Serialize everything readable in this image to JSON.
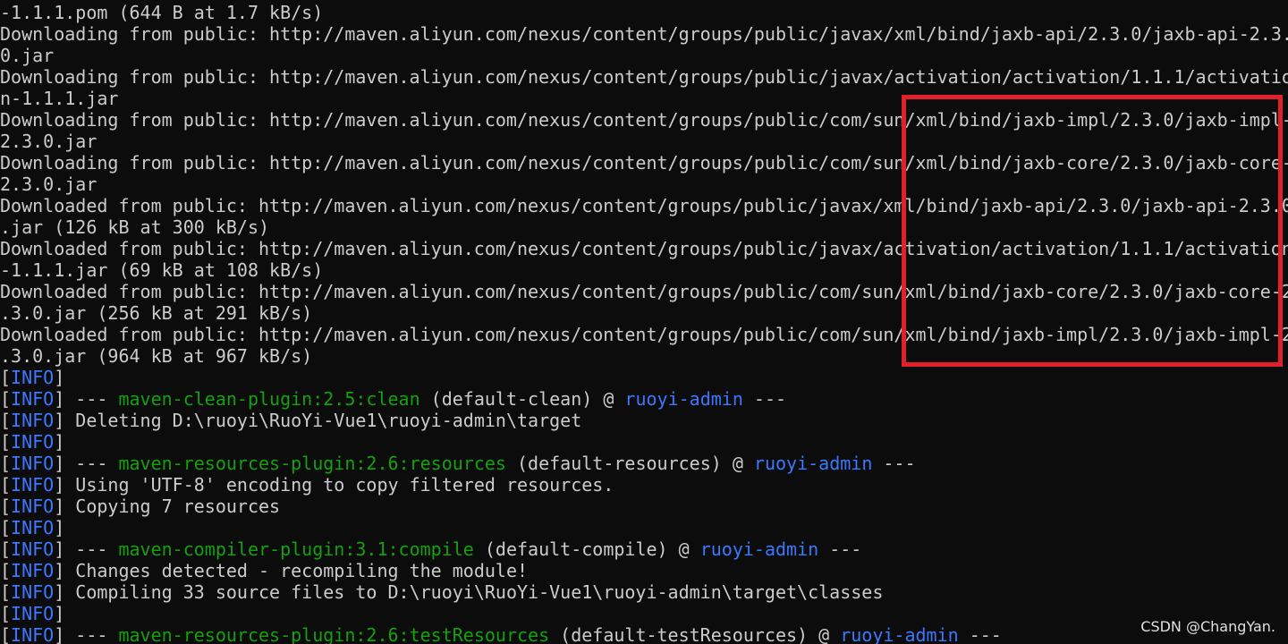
{
  "colors": {
    "background": "#0c0c0c",
    "default_text": "#cccccc",
    "info_tag": "#3b78ff",
    "plugin_green": "#13a10e",
    "artifact_blue": "#3b78ff",
    "highlight_box": "#e0202a"
  },
  "terminal": {
    "lines": [
      {
        "segments": [
          {
            "t": "-1.1.1.pom (644 B at 1.7 kB/s)",
            "c": "default"
          }
        ]
      },
      {
        "segments": [
          {
            "t": "Downloading from public: http://maven.aliyun.com/nexus/content/groups/public/javax/xml/bind/jaxb-api/2.3.0/jaxb-api-2.3.",
            "c": "default"
          }
        ]
      },
      {
        "segments": [
          {
            "t": "0.jar",
            "c": "default"
          }
        ]
      },
      {
        "segments": [
          {
            "t": "Downloading from public: http://maven.aliyun.com/nexus/content/groups/public/javax/activation/activation/1.1.1/activatio",
            "c": "default"
          }
        ]
      },
      {
        "segments": [
          {
            "t": "n-1.1.1.jar",
            "c": "default"
          }
        ]
      },
      {
        "segments": [
          {
            "t": "Downloading from public: http://maven.aliyun.com/nexus/content/groups/public/com/sun/xml/bind/jaxb-impl/2.3.0/jaxb-impl-",
            "c": "default"
          }
        ]
      },
      {
        "segments": [
          {
            "t": "2.3.0.jar",
            "c": "default"
          }
        ]
      },
      {
        "segments": [
          {
            "t": "Downloading from public: http://maven.aliyun.com/nexus/content/groups/public/com/sun/xml/bind/jaxb-core/2.3.0/jaxb-core-",
            "c": "default"
          }
        ]
      },
      {
        "segments": [
          {
            "t": "2.3.0.jar",
            "c": "default"
          }
        ]
      },
      {
        "segments": [
          {
            "t": "Downloaded from public: http://maven.aliyun.com/nexus/content/groups/public/javax/xml/bind/jaxb-api/2.3.0/jaxb-api-2.3.0",
            "c": "default"
          }
        ]
      },
      {
        "segments": [
          {
            "t": ".jar (126 kB at 300 kB/s)",
            "c": "default"
          }
        ]
      },
      {
        "segments": [
          {
            "t": "Downloaded from public: http://maven.aliyun.com/nexus/content/groups/public/javax/activation/activation/1.1.1/activation",
            "c": "default"
          }
        ]
      },
      {
        "segments": [
          {
            "t": "-1.1.1.jar (69 kB at 108 kB/s)",
            "c": "default"
          }
        ]
      },
      {
        "segments": [
          {
            "t": "Downloaded from public: http://maven.aliyun.com/nexus/content/groups/public/com/sun/xml/bind/jaxb-core/2.3.0/jaxb-core-2",
            "c": "default"
          }
        ]
      },
      {
        "segments": [
          {
            "t": ".3.0.jar (256 kB at 291 kB/s)",
            "c": "default"
          }
        ]
      },
      {
        "segments": [
          {
            "t": "Downloaded from public: http://maven.aliyun.com/nexus/content/groups/public/com/sun/xml/bind/jaxb-impl/2.3.0/jaxb-impl-2",
            "c": "default"
          }
        ]
      },
      {
        "segments": [
          {
            "t": ".3.0.jar (964 kB at 967 kB/s)",
            "c": "default"
          }
        ]
      },
      {
        "segments": [
          {
            "t": "[",
            "c": "default"
          },
          {
            "t": "INFO",
            "c": "info"
          },
          {
            "t": "]",
            "c": "default"
          }
        ]
      },
      {
        "segments": [
          {
            "t": "[",
            "c": "default"
          },
          {
            "t": "INFO",
            "c": "info"
          },
          {
            "t": "] --- ",
            "c": "default"
          },
          {
            "t": "maven-clean-plugin:2.5:clean",
            "c": "green"
          },
          {
            "t": " (default-clean) @ ",
            "c": "default"
          },
          {
            "t": "ruoyi-admin",
            "c": "blue"
          },
          {
            "t": " ---",
            "c": "default"
          }
        ]
      },
      {
        "segments": [
          {
            "t": "[",
            "c": "default"
          },
          {
            "t": "INFO",
            "c": "info"
          },
          {
            "t": "] Deleting D:\\ruoyi\\RuoYi-Vue1\\ruoyi-admin\\target",
            "c": "default"
          }
        ]
      },
      {
        "segments": [
          {
            "t": "[",
            "c": "default"
          },
          {
            "t": "INFO",
            "c": "info"
          },
          {
            "t": "]",
            "c": "default"
          }
        ]
      },
      {
        "segments": [
          {
            "t": "[",
            "c": "default"
          },
          {
            "t": "INFO",
            "c": "info"
          },
          {
            "t": "] --- ",
            "c": "default"
          },
          {
            "t": "maven-resources-plugin:2.6:resources",
            "c": "green"
          },
          {
            "t": " (default-resources) @ ",
            "c": "default"
          },
          {
            "t": "ruoyi-admin",
            "c": "blue"
          },
          {
            "t": " ---",
            "c": "default"
          }
        ]
      },
      {
        "segments": [
          {
            "t": "[",
            "c": "default"
          },
          {
            "t": "INFO",
            "c": "info"
          },
          {
            "t": "] Using 'UTF-8' encoding to copy filtered resources.",
            "c": "default"
          }
        ]
      },
      {
        "segments": [
          {
            "t": "[",
            "c": "default"
          },
          {
            "t": "INFO",
            "c": "info"
          },
          {
            "t": "] Copying 7 resources",
            "c": "default"
          }
        ]
      },
      {
        "segments": [
          {
            "t": "[",
            "c": "default"
          },
          {
            "t": "INFO",
            "c": "info"
          },
          {
            "t": "]",
            "c": "default"
          }
        ]
      },
      {
        "segments": [
          {
            "t": "[",
            "c": "default"
          },
          {
            "t": "INFO",
            "c": "info"
          },
          {
            "t": "] --- ",
            "c": "default"
          },
          {
            "t": "maven-compiler-plugin:3.1:compile",
            "c": "green"
          },
          {
            "t": " (default-compile) @ ",
            "c": "default"
          },
          {
            "t": "ruoyi-admin",
            "c": "blue"
          },
          {
            "t": " ---",
            "c": "default"
          }
        ]
      },
      {
        "segments": [
          {
            "t": "[",
            "c": "default"
          },
          {
            "t": "INFO",
            "c": "info"
          },
          {
            "t": "] Changes detected - recompiling the module!",
            "c": "default"
          }
        ]
      },
      {
        "segments": [
          {
            "t": "[",
            "c": "default"
          },
          {
            "t": "INFO",
            "c": "info"
          },
          {
            "t": "] Compiling 33 source files to D:\\ruoyi\\RuoYi-Vue1\\ruoyi-admin\\target\\classes",
            "c": "default"
          }
        ]
      },
      {
        "segments": [
          {
            "t": "[",
            "c": "default"
          },
          {
            "t": "INFO",
            "c": "info"
          },
          {
            "t": "]",
            "c": "default"
          }
        ]
      },
      {
        "segments": [
          {
            "t": "[",
            "c": "default"
          },
          {
            "t": "INFO",
            "c": "info"
          },
          {
            "t": "] --- ",
            "c": "default"
          },
          {
            "t": "maven-resources-plugin:2.6:testResources",
            "c": "green"
          },
          {
            "t": " (default-testResources) @ ",
            "c": "default"
          },
          {
            "t": "ruoyi-admin",
            "c": "blue"
          },
          {
            "t": " ---",
            "c": "default"
          }
        ]
      }
    ]
  },
  "watermark": {
    "text": "CSDN @ChangYan."
  }
}
